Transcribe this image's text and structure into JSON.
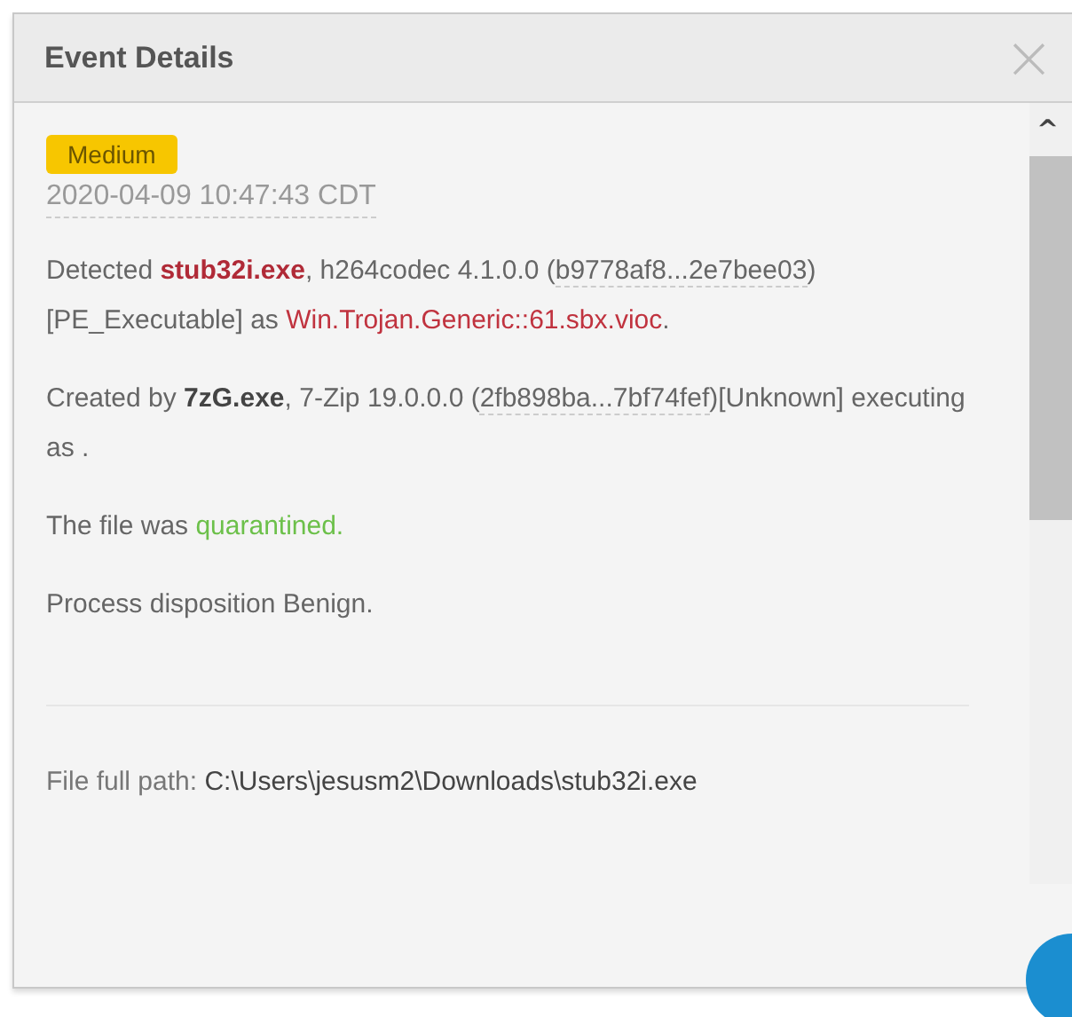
{
  "dialog": {
    "title": "Event Details",
    "close": "×"
  },
  "severity": {
    "label": "Medium"
  },
  "timestamp": "2020-04-09 10:47:43 CDT",
  "paragraphs": [
    [
      {
        "kind": "plain",
        "text": "Detected "
      },
      {
        "kind": "threat-file",
        "text": "stub32i.exe"
      },
      {
        "kind": "plain",
        "text": ", h264codec 4.1.0.0 ("
      },
      {
        "kind": "hash",
        "text": "b9778af8...2e7bee03"
      },
      {
        "kind": "plain",
        "text": ")[PE_Executable] as "
      },
      {
        "kind": "threat",
        "text": "Win.Trojan.Generic::61.sbx.vioc"
      },
      {
        "kind": "plain",
        "text": "."
      }
    ],
    [
      {
        "kind": "plain",
        "text": "Created by "
      },
      {
        "kind": "file",
        "text": "7zG.exe"
      },
      {
        "kind": "plain",
        "text": ", 7-Zip 19.0.0.0 ("
      },
      {
        "kind": "hash",
        "text": "2fb898ba...7bf74fef"
      },
      {
        "kind": "plain",
        "text": ")[Unknown] executing as ."
      }
    ],
    [
      {
        "kind": "plain",
        "text": "The file was "
      },
      {
        "kind": "ok",
        "text": "quarantined."
      }
    ],
    [
      {
        "kind": "plain",
        "text": "Process disposition Benign."
      }
    ]
  ],
  "file_path": {
    "label": "File full path:",
    "value": "C:\\Users\\jesusm2\\Downloads\\stub32i.exe"
  },
  "scrollbar": {
    "up": "^"
  }
}
